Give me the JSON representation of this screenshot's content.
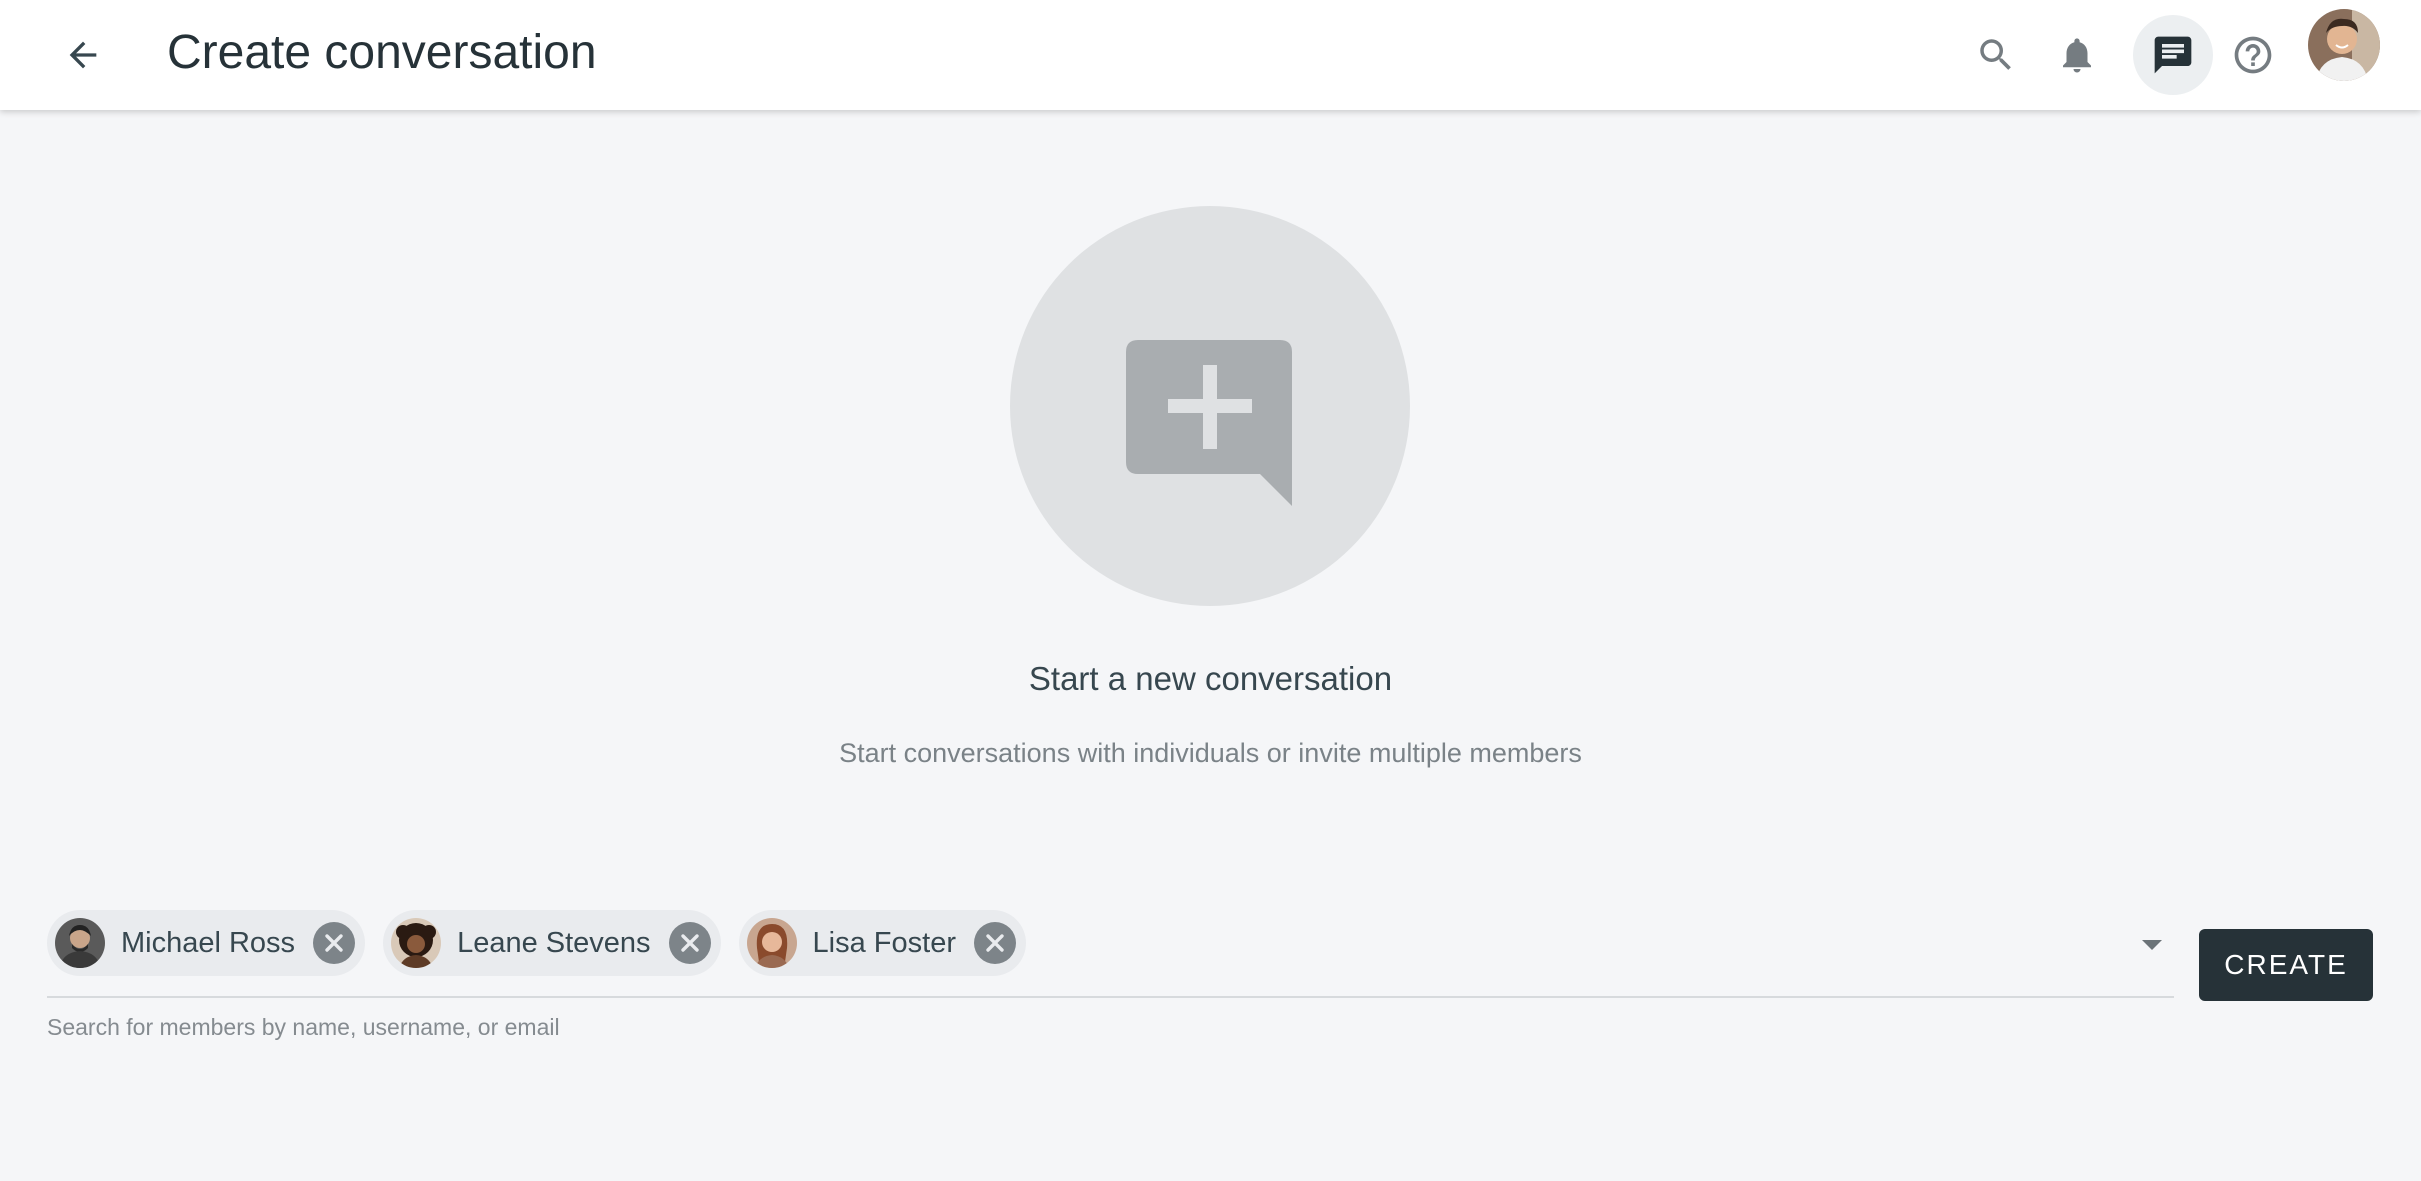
{
  "header": {
    "title": "Create conversation",
    "icons": [
      "back-arrow-icon",
      "search-icon",
      "bell-icon",
      "chat-icon",
      "help-icon"
    ]
  },
  "hero": {
    "icon": "add-comment-icon",
    "title": "Start a new conversation",
    "subtitle": "Start conversations with individuals or invite multiple members"
  },
  "members": {
    "selected": [
      {
        "name": "Michael Ross"
      },
      {
        "name": "Leane Stevens"
      },
      {
        "name": "Lisa Foster"
      }
    ],
    "helper": "Search for members by name, username, or email"
  },
  "actions": {
    "create_label": "CREATE"
  },
  "colors": {
    "primary_dark": "#263238",
    "background": "#f5f6f8",
    "chip": "#e9ebee",
    "hero_circle": "#dfe1e3",
    "hero_icon": "#a9adb0"
  }
}
